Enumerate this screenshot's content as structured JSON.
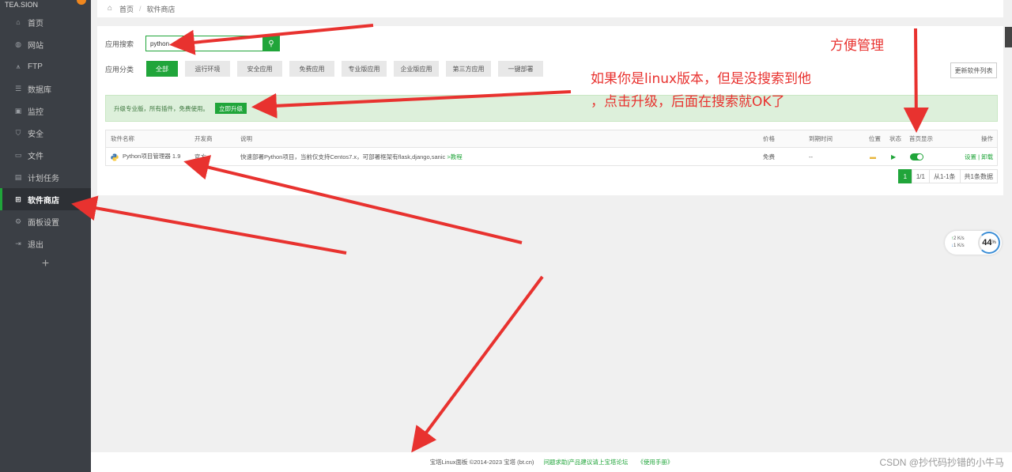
{
  "sidebar": {
    "logo_text": "TEA.SION",
    "items": [
      {
        "label": "首页",
        "icon": "home-icon"
      },
      {
        "label": "网站",
        "icon": "globe-icon"
      },
      {
        "label": "FTP",
        "icon": "ftp-icon"
      },
      {
        "label": "数据库",
        "icon": "database-icon"
      },
      {
        "label": "监控",
        "icon": "monitor-icon"
      },
      {
        "label": "安全",
        "icon": "shield-icon"
      },
      {
        "label": "文件",
        "icon": "folder-icon"
      },
      {
        "label": "计划任务",
        "icon": "calendar-icon"
      },
      {
        "label": "软件商店",
        "icon": "grid-icon"
      },
      {
        "label": "面板设置",
        "icon": "gear-icon"
      },
      {
        "label": "退出",
        "icon": "logout-icon"
      }
    ],
    "active_index": 8,
    "add_label": "+"
  },
  "breadcrumb": {
    "home": "首页",
    "sep": "/",
    "current": "软件商店"
  },
  "search": {
    "label": "应用搜索",
    "value": "python"
  },
  "categories": {
    "label": "应用分类",
    "items": [
      "全部",
      "运行环境",
      "安全应用",
      "免费应用",
      "专业版应用",
      "企业版应用",
      "第三方应用",
      "一键部署"
    ],
    "selected_index": 0
  },
  "update_list_label": "更新软件列表",
  "notice": {
    "text": "升级专业版，所有插件，免费使用。",
    "button": "立即升级"
  },
  "table": {
    "headers": [
      "软件名称",
      "开发商",
      "说明",
      "价格",
      "到期时间",
      "位置",
      "状态",
      "首页显示",
      "操作"
    ],
    "rows": [
      {
        "name": "Python项目管理器 1.9",
        "developer": "官方",
        "desc": "快速部署Python项目，当前仅支持Centos7.x，可部署框架有flask,django,sanic",
        "desc_link": ">教程",
        "price": "免费",
        "expire": "--",
        "actions": [
          "设置",
          "|",
          "卸载"
        ]
      }
    ]
  },
  "pager": {
    "current": "1",
    "pages": "1/1",
    "range": "从1-1条",
    "total": "共1条数据"
  },
  "speed": {
    "up": "2",
    "down": "1",
    "unit": "K/s",
    "percent": "44",
    "percent_unit": "%"
  },
  "footer": {
    "copyright": "宝塔Linux面板 ©2014-2023 宝塔 (bt.cn)",
    "forum": "问题求助|产品建议请上宝塔论坛",
    "manual": "《使用手册》"
  },
  "watermark": "CSDN @抄代码抄错的小牛马",
  "annotations": {
    "manage": "方便管理",
    "linux_1": "如果你是linux版本，但是没搜索到他",
    "linux_2": "，点击升级，后面在搜索就OK了"
  },
  "colors": {
    "accent": "#20a53a",
    "sidebar": "#3b3f45",
    "annotation": "#e8322f"
  }
}
